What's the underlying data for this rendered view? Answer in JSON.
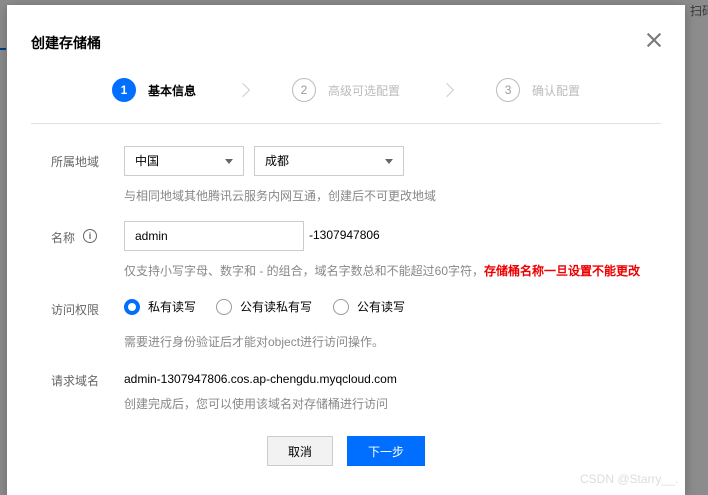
{
  "background": {
    "fragment_top_right": "扫码"
  },
  "modal": {
    "title": "创建存储桶",
    "close_icon": "close-icon"
  },
  "steps": [
    {
      "number": "1",
      "label": "基本信息",
      "active": true
    },
    {
      "number": "2",
      "label": "高级可选配置",
      "active": false
    },
    {
      "number": "3",
      "label": "确认配置",
      "active": false
    }
  ],
  "form": {
    "region": {
      "label": "所属地域",
      "country_value": "中国",
      "city_value": "成都",
      "hint": "与相同地域其他腾讯云服务内网互通，创建后不可更改地域"
    },
    "name": {
      "label": "名称",
      "info_icon": "info-icon",
      "value": "admin",
      "suffix": "-1307947806",
      "hint": "仅支持小写字母、数字和 - 的组合，域名字数总和不能超过60字符，",
      "warning": "存储桶名称一旦设置不能更改"
    },
    "access": {
      "label": "访问权限",
      "options": [
        "私有读写",
        "公有读私有写",
        "公有读写"
      ],
      "selected": "私有读写",
      "hint": "需要进行身份验证后才能对object进行访问操作。"
    },
    "domain": {
      "label": "请求域名",
      "value": "admin-1307947806.cos.ap-chengdu.myqcloud.com",
      "hint": "创建完成后，您可以使用该域名对存储桶进行访问"
    }
  },
  "buttons": {
    "cancel": "取消",
    "next": "下一步"
  },
  "watermark": "CSDN @Starry__.",
  "colors": {
    "accent": "#006eff",
    "warning": "#ee0000"
  }
}
